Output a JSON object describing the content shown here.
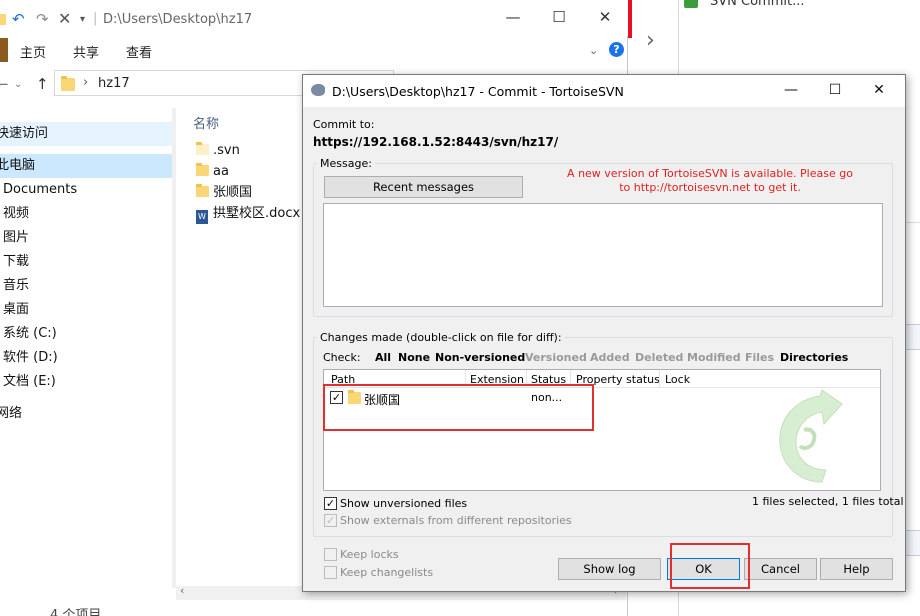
{
  "background": {
    "hint_text": "SVN Commit..."
  },
  "explorer": {
    "path": "D:\\Users\\Desktop\\hz17",
    "ribbon_tabs": [
      "主页",
      "共享",
      "查看"
    ],
    "address": "hz17",
    "nav_items": [
      "快速访问",
      "此电脑",
      "Documents",
      "视频",
      "图片",
      "下载",
      "音乐",
      "桌面",
      "系统 (C:)",
      "软件 (D:)",
      "文档 (E:)",
      "网络"
    ],
    "column_name": "名称",
    "files": [
      ".svn",
      "aa",
      "张顺国",
      "拱墅校区.docx"
    ],
    "status": "4 个项目"
  },
  "dialog": {
    "title": "D:\\Users\\Desktop\\hz17 - Commit - TortoiseSVN",
    "commit_to_label": "Commit to:",
    "commit_url": "https://192.168.1.52:8443/svn/hz17/",
    "message_label": "Message:",
    "recent_messages_button": "Recent messages",
    "notice": "A new version of TortoiseSVN is available. Please go to http://tortoisesvn.net to get it.",
    "changes_label": "Changes made (double-click on file for diff):",
    "check_label": "Check:",
    "check_active": [
      "All",
      "None",
      "Non-versioned"
    ],
    "check_disabled": [
      "Versioned",
      "Added",
      "Deleted",
      "Modified",
      "Files"
    ],
    "check_last": "Directories",
    "columns": [
      "Path",
      "Extension",
      "Status",
      "Property status",
      "Lock"
    ],
    "row": {
      "name": "张顺国",
      "status": "non..."
    },
    "show_unversioned": "Show unversioned files",
    "show_externals": "Show externals from different repositories",
    "selection_summary": "1 files selected, 1 files total",
    "keep_locks": "Keep locks",
    "keep_changelists": "Keep changelists",
    "buttons": {
      "show_log": "Show log",
      "ok": "OK",
      "cancel": "Cancel",
      "help": "Help"
    }
  },
  "colors": {
    "notice": "#e02020",
    "highlight": "#e03030",
    "selection": "#cce8ff"
  }
}
